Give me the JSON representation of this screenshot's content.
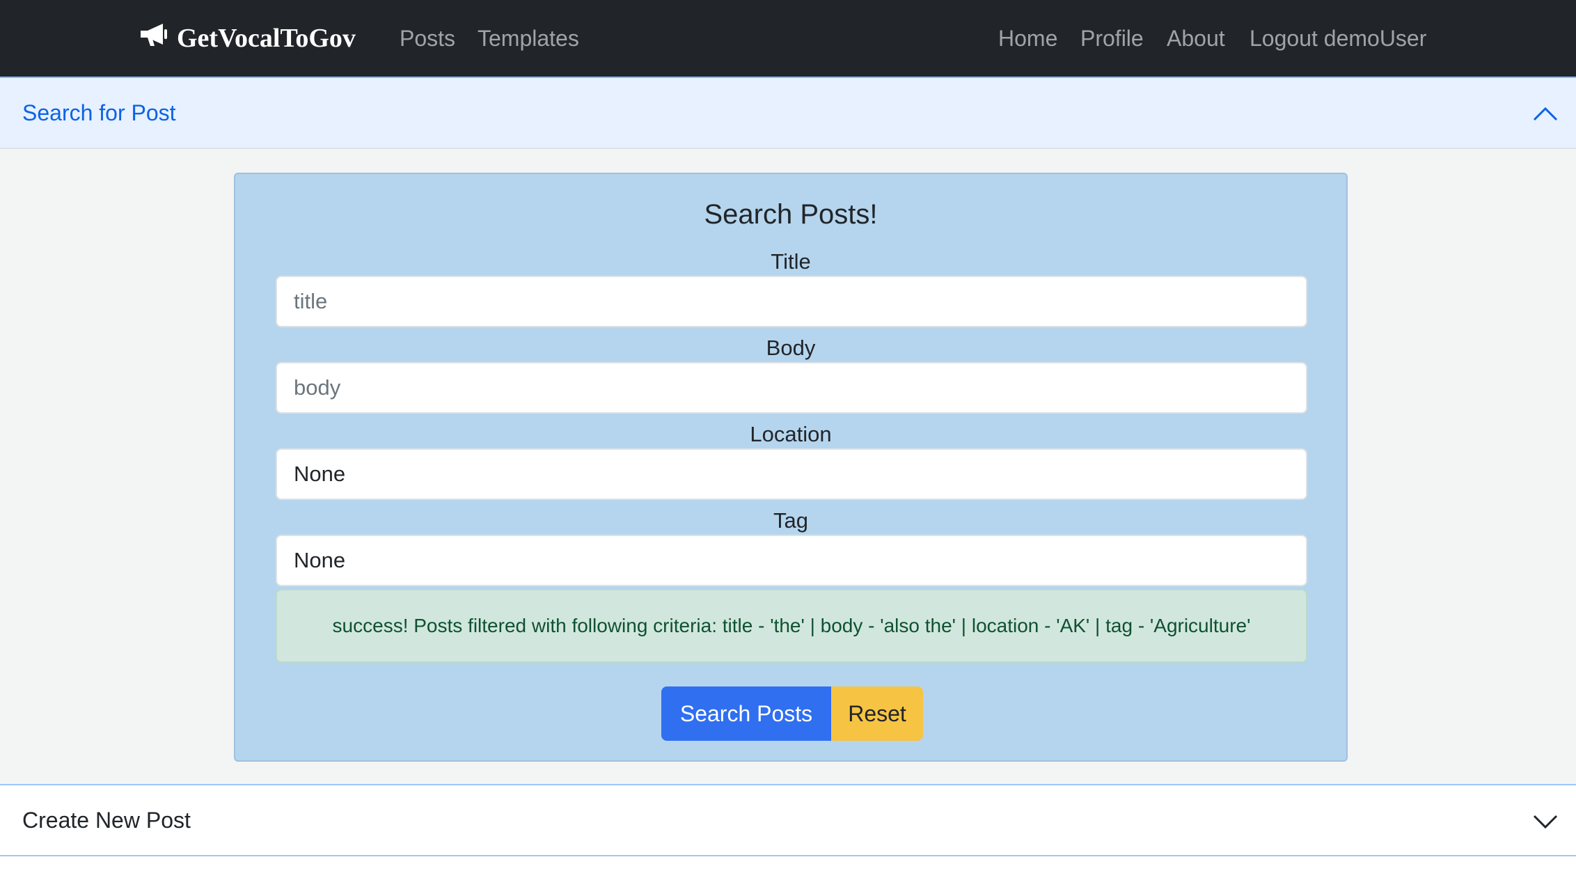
{
  "navbar": {
    "brand": "GetVocalToGov",
    "brand_icon": "megaphone-icon",
    "left_links": [
      "Posts",
      "Templates"
    ],
    "right_links": [
      "Home",
      "Profile",
      "About",
      "Logout demoUser"
    ]
  },
  "search_accordion": {
    "header": "Search for Post",
    "expanded": true,
    "form": {
      "heading": "Search Posts!",
      "title_label": "Title",
      "title_placeholder": "title",
      "body_label": "Body",
      "body_placeholder": "body",
      "location_label": "Location",
      "location_value": "None",
      "tag_label": "Tag",
      "tag_value": "None",
      "alert": "success! Posts filtered with following criteria: title - 'the' | body - 'also the' | location - 'AK' | tag - 'Agriculture'",
      "search_button": "Search Posts",
      "reset_button": "Reset"
    }
  },
  "create_accordion": {
    "header": "Create New Post",
    "expanded": false
  },
  "colors": {
    "navbar_bg": "#212529",
    "accordion_active_bg": "#e7f1ff",
    "accordion_active_text": "#0c63e4",
    "card_bg": "#b5d5ee",
    "alert_bg": "#d1e7dd",
    "primary": "#2f6ff0",
    "warning": "#f6c343"
  }
}
